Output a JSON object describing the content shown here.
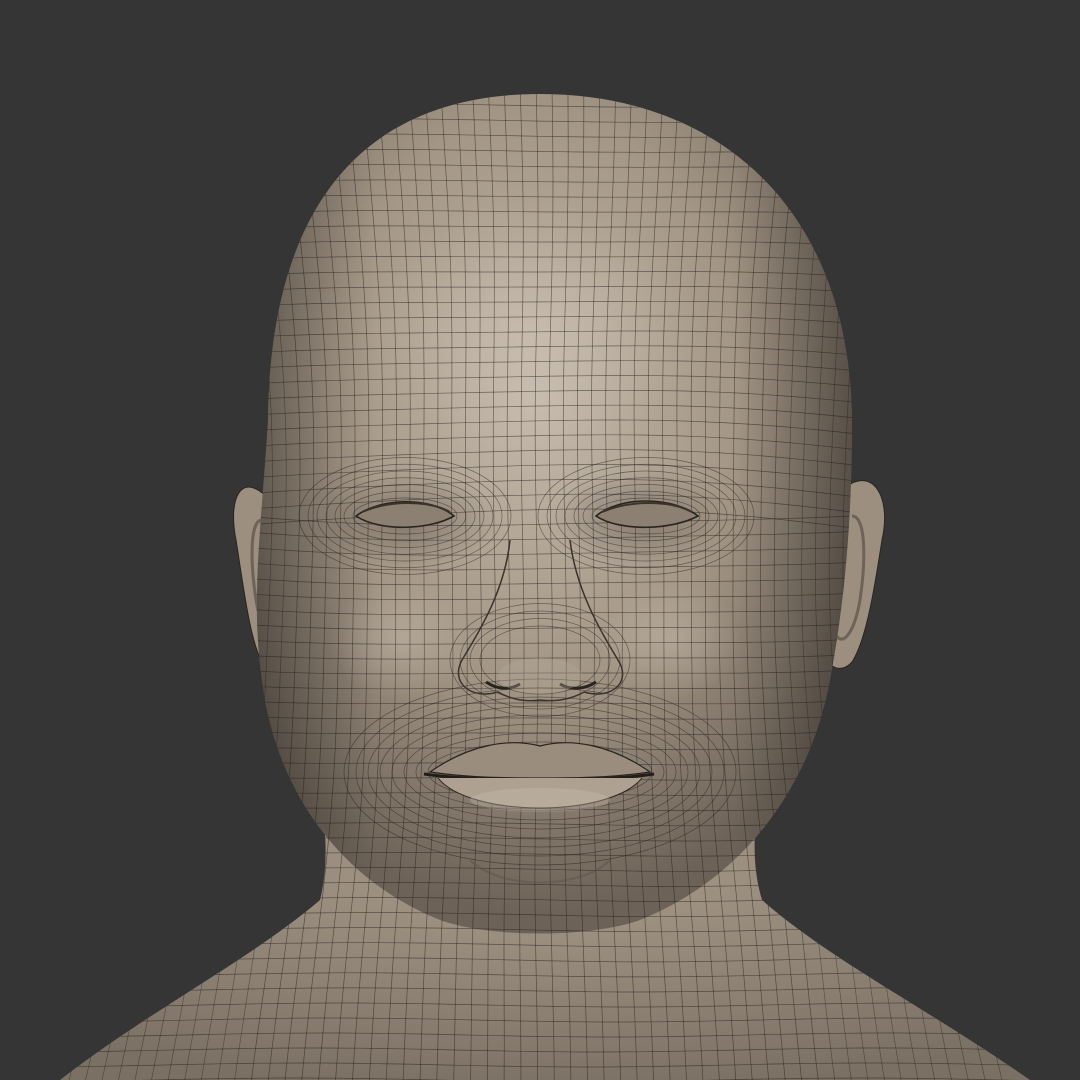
{
  "scene": {
    "subject": "head-and-neck-wireframe",
    "background_color": "#353535",
    "skin_color": "#a39686",
    "skin_highlight": "#c2b7a9",
    "skin_shadow": "#6f655a",
    "wire_color": "#1f1a16"
  }
}
